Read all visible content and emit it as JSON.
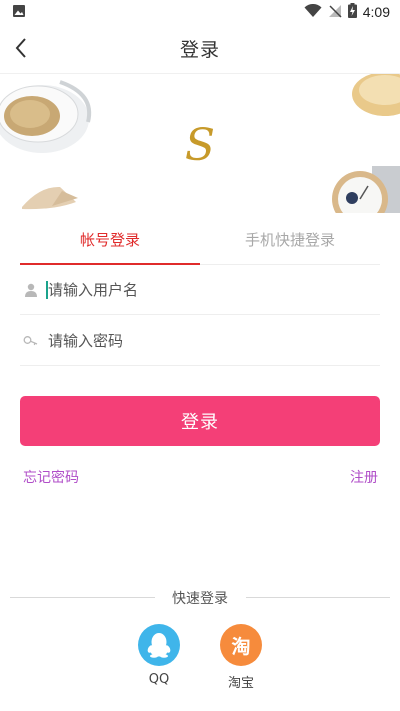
{
  "status_bar": {
    "time": "4:09"
  },
  "header": {
    "title": "登录"
  },
  "tabs": [
    {
      "label": "帐号登录",
      "active": true
    },
    {
      "label": "手机快捷登录",
      "active": false
    }
  ],
  "form": {
    "username_placeholder": "请输入用户名",
    "password_placeholder": "请输入密码"
  },
  "login_button": "登录",
  "links": {
    "forgot": "忘记密码",
    "register": "注册"
  },
  "quick_login": {
    "title": "快速登录",
    "providers": [
      {
        "label": "QQ",
        "icon": "qq-penguin-icon",
        "color": "#3fb5ea"
      },
      {
        "label": "淘宝",
        "icon": "taobao-icon",
        "glyph": "淘",
        "color": "#f68b3c"
      }
    ]
  },
  "colors": {
    "accent": "#e02b2b",
    "button": "#f43f77",
    "link": "#b04ec8"
  }
}
